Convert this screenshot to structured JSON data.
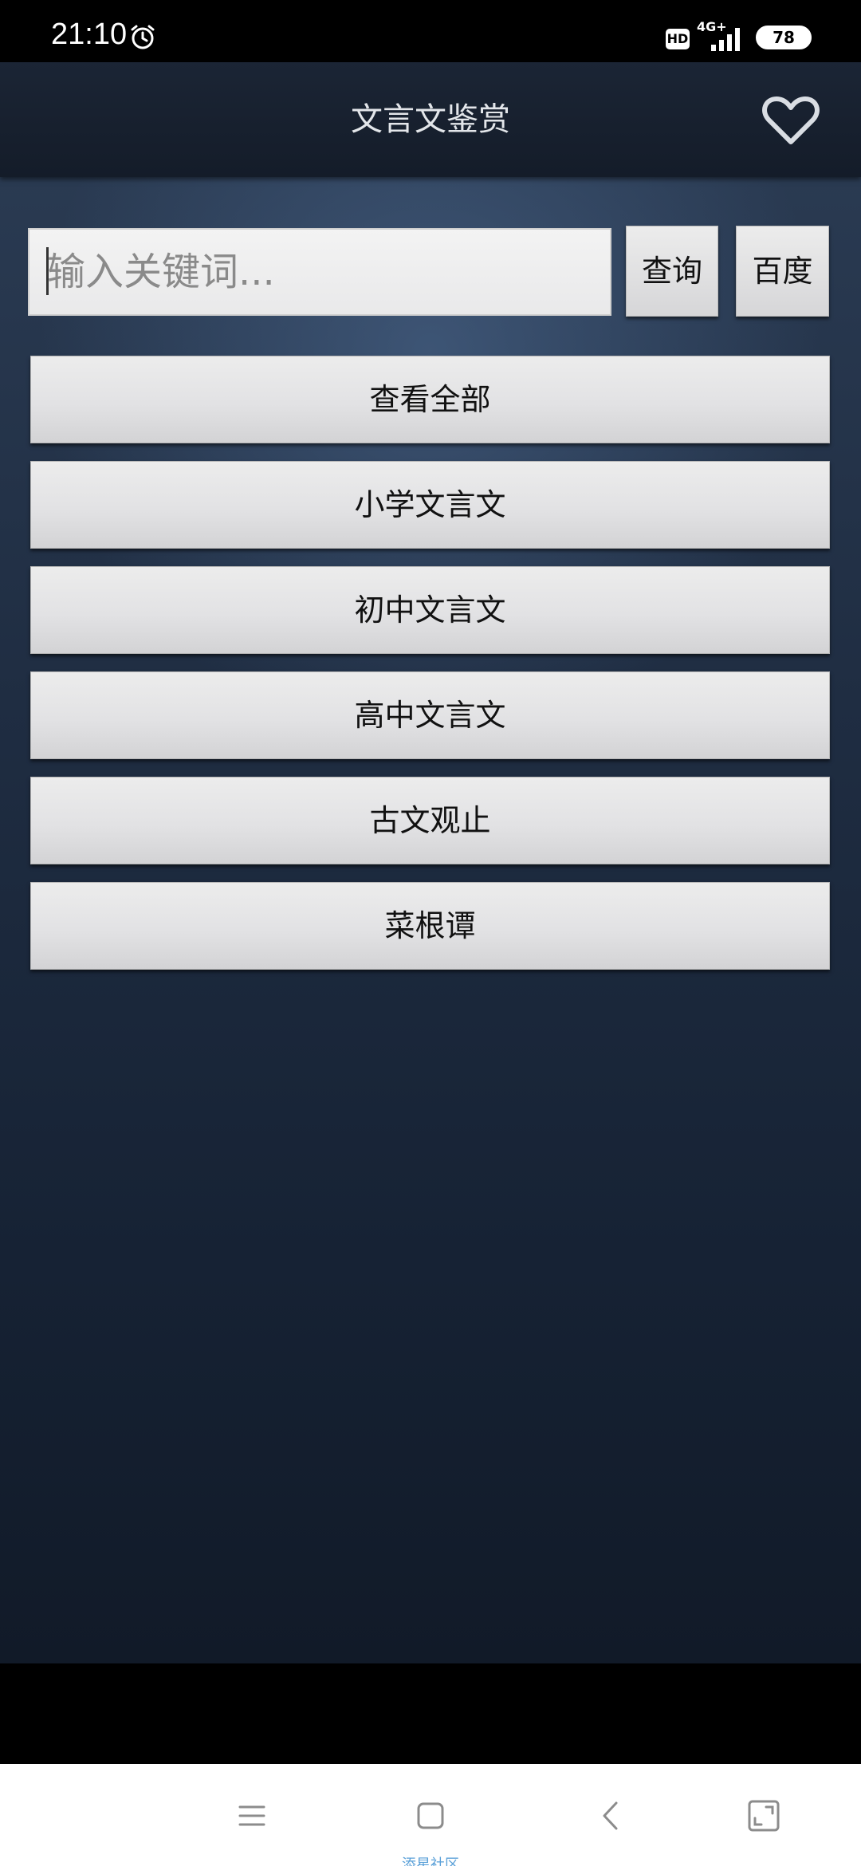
{
  "status_bar": {
    "time": "21:10",
    "alarm_icon": "alarm-clock-icon",
    "hd_label": "HD",
    "network_label": "4G+",
    "signal_icon": "signal-bars-icon",
    "battery_level": "78"
  },
  "header": {
    "title": "文言文鉴赏",
    "favorite_icon": "heart-outline-icon"
  },
  "search": {
    "placeholder": "输入关键词...",
    "value": "",
    "query_label": "查询",
    "baidu_label": "百度"
  },
  "categories": [
    {
      "label": "查看全部"
    },
    {
      "label": "小学文言文"
    },
    {
      "label": "初中文言文"
    },
    {
      "label": "高中文言文"
    },
    {
      "label": "古文观止"
    },
    {
      "label": "菜根谭"
    }
  ],
  "nav_bar": {
    "menu_icon": "menu-icon",
    "home_icon": "home-square-icon",
    "back_icon": "back-chevron-icon",
    "expand_icon": "expand-corners-icon",
    "watermark": "添星社区"
  },
  "colors": {
    "background_top": "#2c3d55",
    "background_bottom": "#111a28",
    "header_bg": "#171f2d",
    "button_face": "#e2e2e4",
    "watermark": "#5aa0d8"
  }
}
